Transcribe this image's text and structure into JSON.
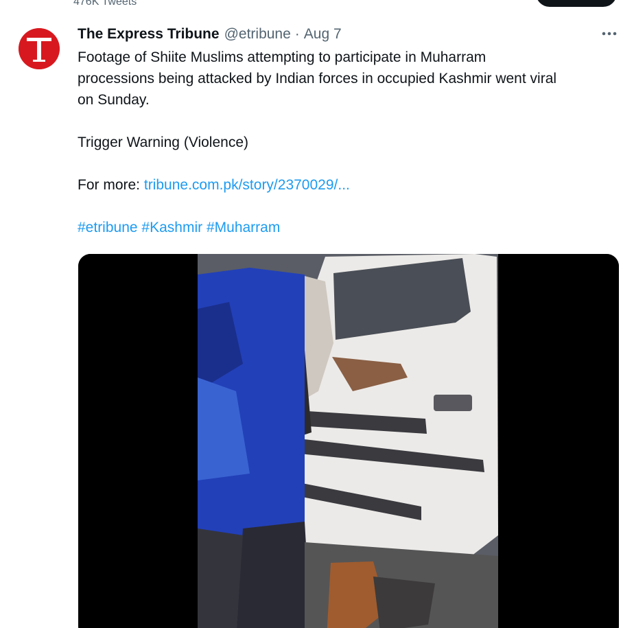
{
  "profile_header": {
    "tweet_count": "476K Tweets"
  },
  "tweet": {
    "author_name": "The Express Tribune",
    "author_handle": "@etribune",
    "separator": "·",
    "date": "Aug 7",
    "more_icon": "more-horizontal-icon",
    "body_line1": "Footage of Shiite Muslims attempting to participate in Muharram",
    "body_line2": "processions being attacked by Indian forces in occupied Kashmir went viral",
    "body_line3": "on Sunday.",
    "trigger_warning": "Trigger Warning (Violence)",
    "for_more_label": "For more: ",
    "link_text": "tribune.com.pk/story/2370029/...",
    "hashtags": [
      "#etribune",
      "#Kashmir",
      "#Muharram"
    ]
  },
  "colors": {
    "avatar_red": "#d7191f",
    "link_blue": "#1d9bf0",
    "secondary_text": "#536471",
    "primary_text": "#0f1419"
  }
}
